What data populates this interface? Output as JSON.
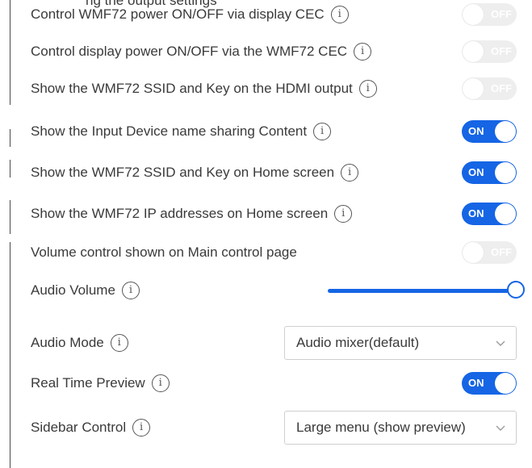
{
  "cut_text": "ng the output settings",
  "settings": [
    {
      "label": "Control WMF72 power ON/OFF via display CEC",
      "control": "toggle",
      "state": "OFF"
    },
    {
      "label": "Control display power ON/OFF via the WMF72 CEC",
      "control": "toggle",
      "state": "OFF"
    },
    {
      "label": "Show the WMF72 SSID and Key on the HDMI output",
      "control": "toggle",
      "state": "OFF"
    },
    {
      "label": "Show the Input Device name sharing Content",
      "control": "toggle",
      "state": "ON"
    },
    {
      "label": "Show the WMF72 SSID and Key on Home screen",
      "control": "toggle",
      "state": "ON"
    },
    {
      "label": "Show the WMF72 IP addresses on Home screen",
      "control": "toggle",
      "state": "ON"
    },
    {
      "label": "Volume control shown on Main control page",
      "control": "toggle",
      "state": "OFF",
      "no_info": true
    },
    {
      "label": "Audio Volume",
      "control": "slider",
      "value": 1.0
    },
    {
      "label": "Audio Mode",
      "control": "select",
      "value": "Audio mixer(default)"
    },
    {
      "label": "Real Time Preview",
      "control": "toggle",
      "state": "ON"
    },
    {
      "label": "Sidebar Control",
      "control": "select",
      "value": "Large menu (show preview)"
    }
  ],
  "icons": {
    "info": "info-icon",
    "chevron": "chevron-down-icon"
  },
  "colors": {
    "accent": "#1565e5",
    "toggle_off": "#eeeeee",
    "text": "#3a3a3a"
  }
}
